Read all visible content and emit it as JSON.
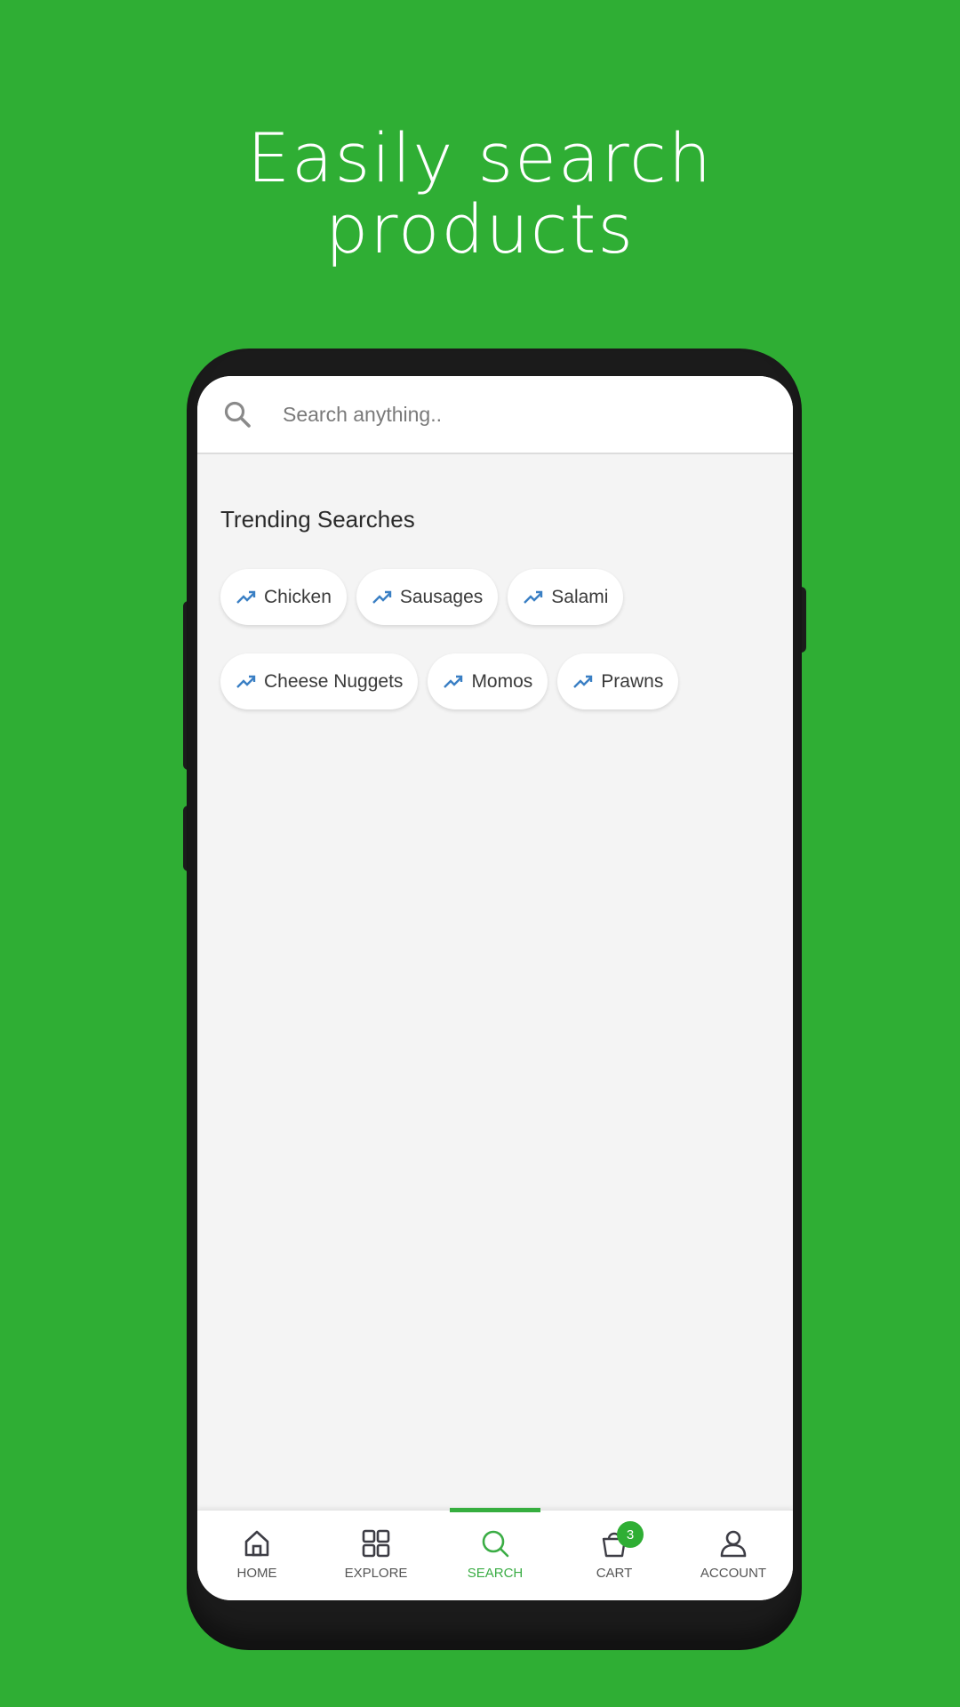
{
  "promo": {
    "headline_line1": "Easily search",
    "headline_line2": "products"
  },
  "search": {
    "placeholder": "Search anything..",
    "value": ""
  },
  "trending": {
    "title": "Trending Searches",
    "rows": [
      [
        {
          "label": "Chicken"
        },
        {
          "label": "Sausages"
        },
        {
          "label": "Salami"
        }
      ],
      [
        {
          "label": "Cheese Nuggets"
        },
        {
          "label": "Momos"
        },
        {
          "label": "Prawns"
        }
      ]
    ]
  },
  "bottom_nav": {
    "items": [
      {
        "label": "HOME",
        "icon": "home-icon",
        "active": false
      },
      {
        "label": "EXPLORE",
        "icon": "grid-icon",
        "active": false
      },
      {
        "label": "SEARCH",
        "icon": "search-icon",
        "active": true
      },
      {
        "label": "CART",
        "icon": "bag-icon",
        "active": false,
        "badge": "3"
      },
      {
        "label": "ACCOUNT",
        "icon": "user-icon",
        "active": false
      }
    ]
  },
  "colors": {
    "background": "#2fae34",
    "accent": "#36ae3f",
    "trend_icon": "#3a7fc4",
    "phone_body": "#1b1b1b",
    "screen_bg": "#f4f4f4"
  }
}
